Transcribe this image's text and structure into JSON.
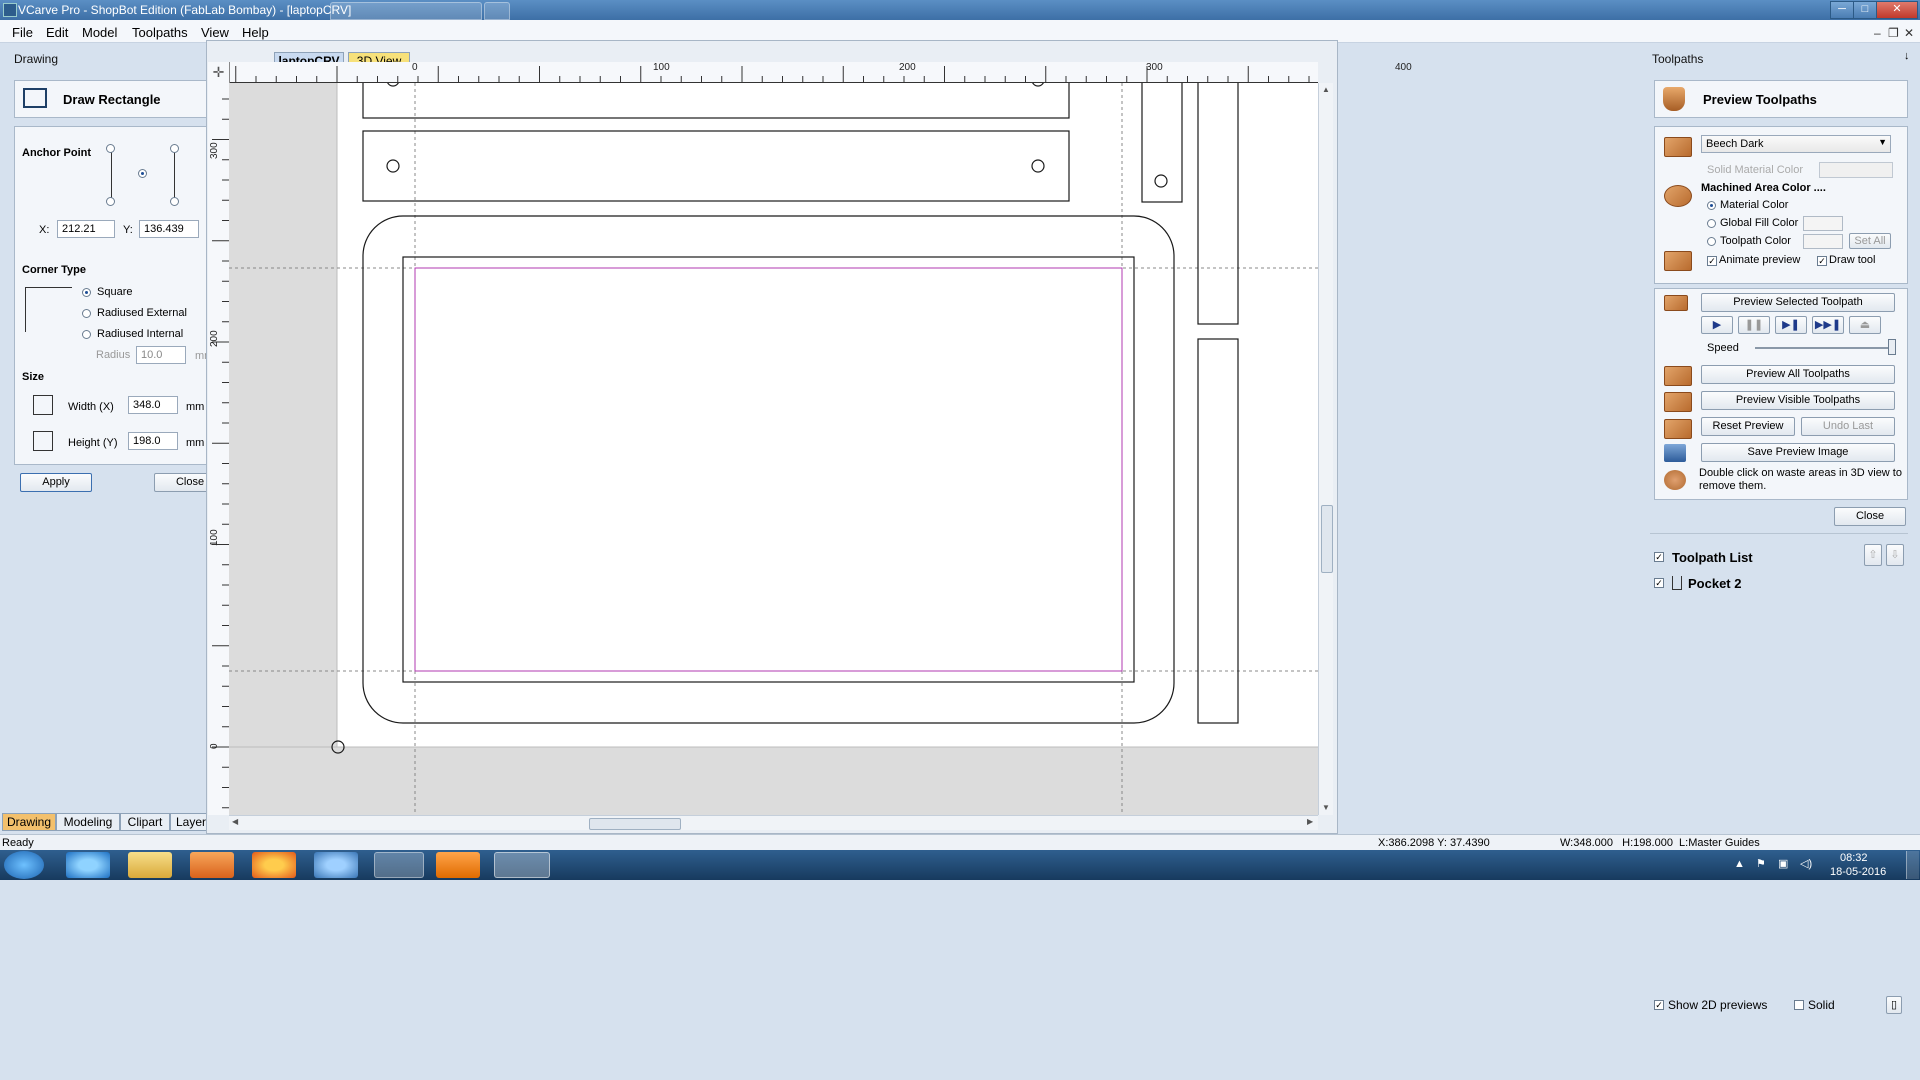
{
  "window": {
    "title": "VCarve Pro - ShopBot Edition (FabLab Bombay) - [laptopCRV]",
    "buttons": [
      "─",
      "□",
      "✕"
    ]
  },
  "menu": [
    "File",
    "Edit",
    "Model",
    "Toolpaths",
    "View",
    "Help"
  ],
  "mdi_controls": [
    "–",
    "❐",
    "✕"
  ],
  "left_panel": {
    "header": "Drawing",
    "pin": "↓",
    "tool_title": "Draw Rectangle",
    "anchor_label": "Anchor Point",
    "x_label": "X:",
    "x_value": "212.21",
    "y_label": "Y:",
    "y_value": "136.439",
    "corner_label": "Corner Type",
    "corner_options": [
      "Square",
      "Radiused External",
      "Radiused Internal"
    ],
    "radius_label": "Radius",
    "radius_value": "10.0",
    "radius_unit": "mm",
    "size_label": "Size",
    "width_label": "Width (X)",
    "width_value": "348.0",
    "width_unit": "mm",
    "height_label": "Height (Y)",
    "height_value": "198.0",
    "height_unit": "mm",
    "apply": "Apply",
    "close": "Close"
  },
  "doc_tabs": [
    "laptopCRV",
    "3D View"
  ],
  "ruler": {
    "h_labels": [
      "0",
      "100",
      "200",
      "300",
      "400"
    ],
    "v_labels": [
      "300",
      "200",
      "100",
      "0"
    ]
  },
  "bottom_tabs": [
    "Drawing",
    "Modeling",
    "Clipart",
    "Layers"
  ],
  "right_panel": {
    "header": "Toolpaths",
    "pin": "↓",
    "preview_title": "Preview Toolpaths",
    "material": "Beech Dark",
    "solid_material_color": "Solid Material Color",
    "machined_area": "Machined Area Color ....",
    "machined_options": [
      "Material Color",
      "Global Fill Color",
      "Toolpath Color"
    ],
    "set_all": "Set All",
    "animate_preview": "Animate preview",
    "draw_tool": "Draw tool",
    "preview_selected": "Preview Selected Toolpath",
    "speed": "Speed",
    "preview_all": "Preview All Toolpaths",
    "preview_visible": "Preview Visible Toolpaths",
    "reset_preview": "Reset Preview",
    "undo_last": "Undo Last",
    "save_preview": "Save Preview Image",
    "hint": "Double click on waste areas in 3D view to remove them.",
    "close": "Close",
    "list_title": "Toolpath List",
    "items": [
      "Pocket 2"
    ],
    "show_2d": "Show 2D previews",
    "solid": "Solid"
  },
  "status": {
    "left": "Ready",
    "coords": "X:386.2098 Y: 37.4390",
    "size": "W:348.000   H:198.000  L:Master Guides"
  },
  "taskbar": {
    "time": "08:32",
    "date": "18-05-2016"
  }
}
